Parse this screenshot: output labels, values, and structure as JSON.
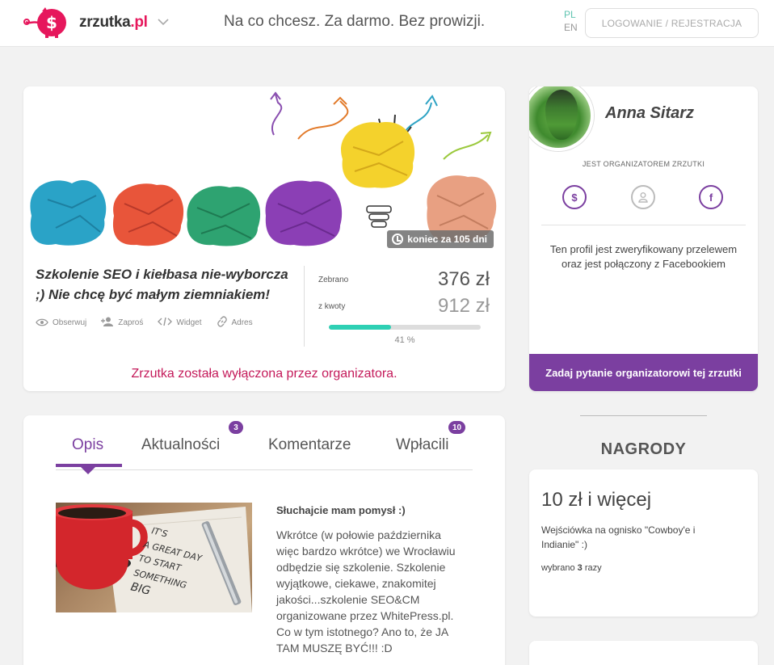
{
  "header": {
    "logo_text_main": "zrzutka",
    "logo_text_tld": ".pl",
    "tagline": "Na co chcesz. Za darmo. Bez prowizji.",
    "lang_pl": "PL",
    "lang_en": "EN",
    "login_label": "LOGOWANIE / REJESTRACJA"
  },
  "campaign": {
    "timer": "koniec za 105 dni",
    "title": "Szkolenie SEO i kiełbasa nie-wyborcza ;) Nie chcę być małym ziemniakiem!",
    "actions": [
      {
        "icon": "eye-icon",
        "label": "Obserwuj"
      },
      {
        "icon": "user-plus-icon",
        "label": "Zaproś"
      },
      {
        "icon": "code-icon",
        "label": "Widget"
      },
      {
        "icon": "link-icon",
        "label": "Adres"
      }
    ],
    "collected_label": "Zebrano",
    "collected_value": "376 zł",
    "goal_label": "z kwoty",
    "goal_value": "912 zł",
    "progress_fraction": 0.41,
    "progress_text": "41 %",
    "disabled_message": "Zrzutka została wyłączona przez organizatora."
  },
  "organizer": {
    "name": "Anna Sitarz",
    "role": "JEST ORGANIZATOREM ZRZUTKI",
    "verified_text": "Ten profil jest zweryfikowany przelewem oraz jest połączony z Facebookiem",
    "ask_button": "Zadaj pytanie organizatorowi tej zrzutki",
    "social_icons": [
      "dollar-icon",
      "user-icon",
      "facebook-icon"
    ]
  },
  "tabs": [
    {
      "label": "Opis",
      "badge": null,
      "active": true
    },
    {
      "label": "Aktualności",
      "badge": "3",
      "active": false
    },
    {
      "label": "Komentarze",
      "badge": null,
      "active": false
    },
    {
      "label": "Wpłacili",
      "badge": "10",
      "active": false
    }
  ],
  "description": {
    "heading": "Słuchajcie mam pomysł :)",
    "text": "Wkrótce (w połowie października więc bardzo wkrótce) we Wrocławiu odbędzie się szkolenie. Szkolenie wyjątkowe, ciekawe, znakomitej jakości...szkolenie SEO&CM organizowane przez WhitePress.pl. Co w tym istotnego? Ano to, że JA TAM MUSZĘ BYĆ!!! :D",
    "image_text": [
      "IT'S",
      "A GREAT DAY",
      "TO START",
      "SOMETHING",
      "BIG"
    ]
  },
  "rewards": {
    "title": "NAGRODY",
    "items": [
      {
        "amount": "10 zł i więcej",
        "description": "Wejściówka na ognisko \"Cowboy'e i Indianie\" :)",
        "count_prefix": "wybrano",
        "count": "3",
        "count_suffix": "razy"
      }
    ]
  },
  "colors": {
    "brand_pink": "#e6175c",
    "accent_purple": "#7b3fa0",
    "progress_teal": "#2ed0b4",
    "alert_red": "#c41a5a"
  }
}
